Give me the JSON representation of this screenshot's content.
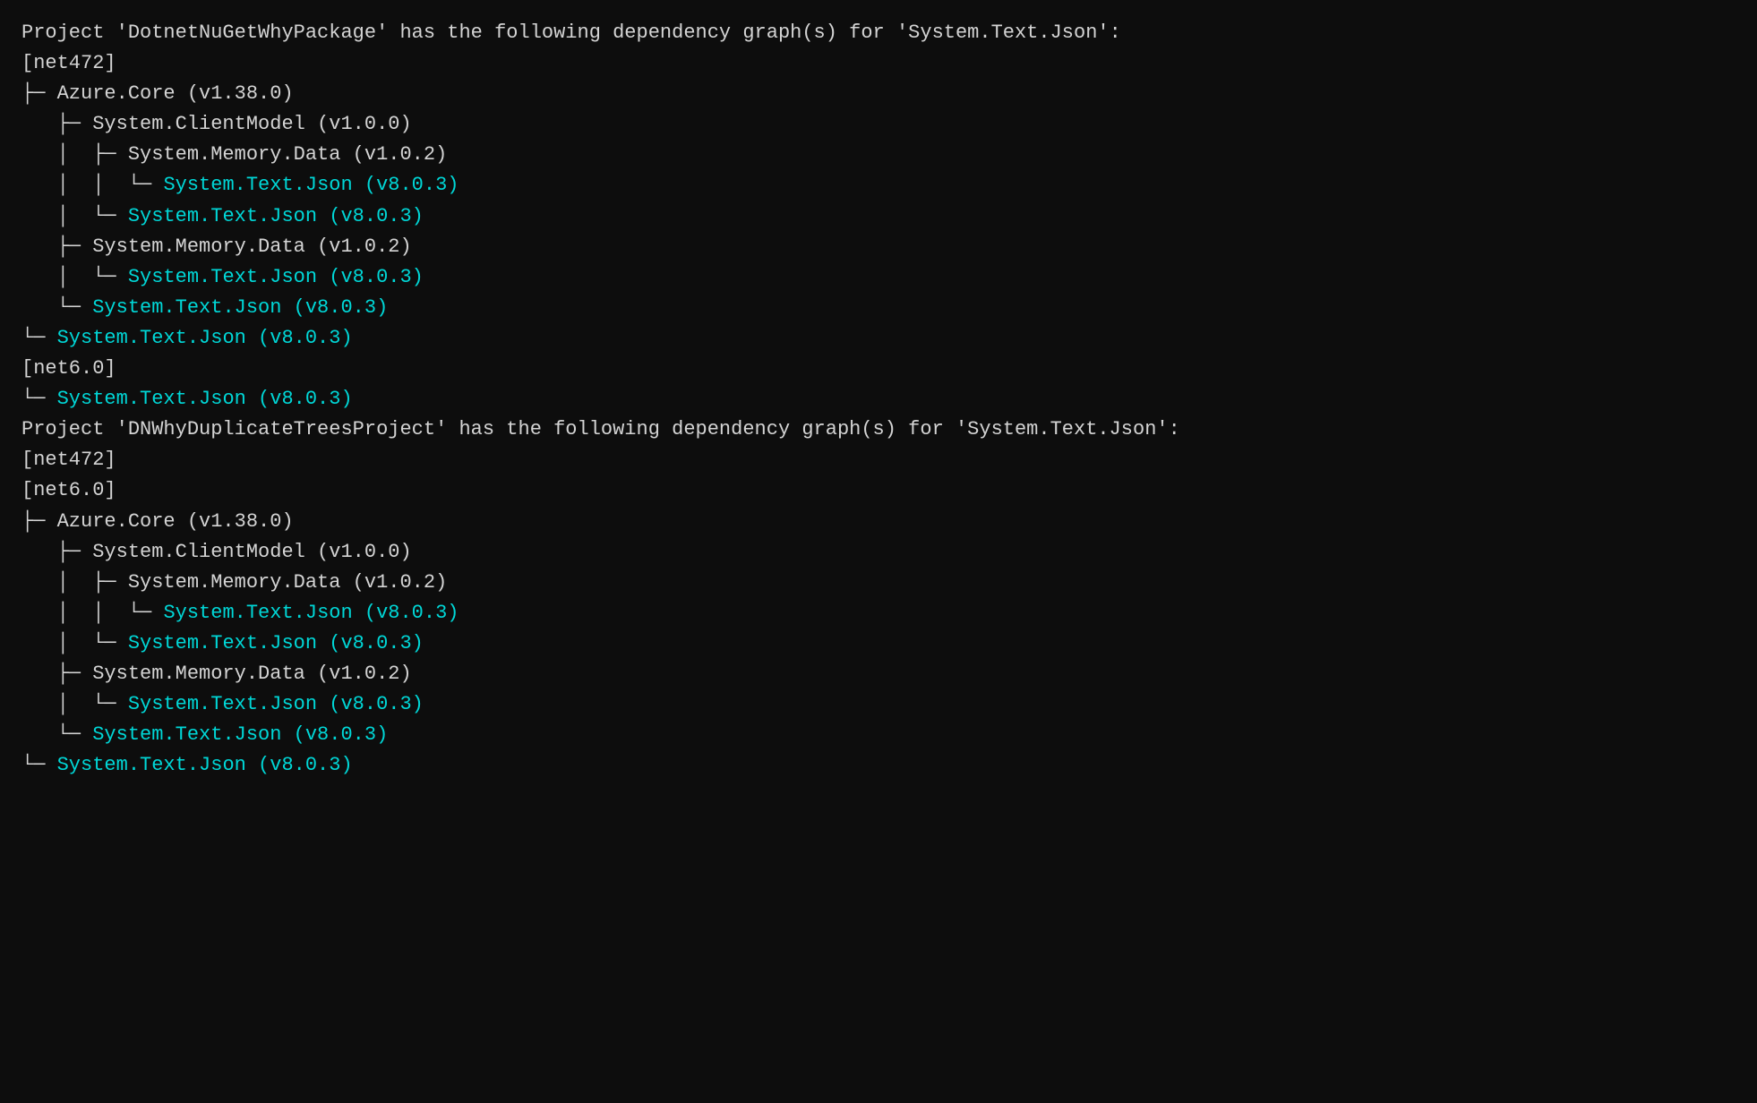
{
  "terminal": {
    "lines": [
      {
        "type": "white",
        "text": "Project 'DotnetNuGetWhyPackage' has the following dependency graph(s) for 'System.Text.Json':"
      },
      {
        "type": "white",
        "text": ""
      },
      {
        "type": "white",
        "text": "[net472]"
      },
      {
        "type": "white",
        "text": ""
      },
      {
        "type": "white",
        "text": "├─ Azure.Core (v1.38.0)"
      },
      {
        "type": "white",
        "text": "   ├─ System.ClientModel (v1.0.0)"
      },
      {
        "type": "white",
        "text": "   │  ├─ System.Memory.Data (v1.0.2)"
      },
      {
        "type": "mixed",
        "prefix": "   │  │  └─ ",
        "cyan": "System.Text.Json (v8.0.3)",
        "suffix": ""
      },
      {
        "type": "mixed",
        "prefix": "   │  └─ ",
        "cyan": "System.Text.Json (v8.0.3)",
        "suffix": ""
      },
      {
        "type": "white",
        "text": "   ├─ System.Memory.Data (v1.0.2)"
      },
      {
        "type": "mixed",
        "prefix": "   │  └─ ",
        "cyan": "System.Text.Json (v8.0.3)",
        "suffix": ""
      },
      {
        "type": "mixed",
        "prefix": "   └─ ",
        "cyan": "System.Text.Json (v8.0.3)",
        "suffix": ""
      },
      {
        "type": "mixed",
        "prefix": "└─ ",
        "cyan": "System.Text.Json (v8.0.3)",
        "suffix": ""
      },
      {
        "type": "white",
        "text": ""
      },
      {
        "type": "white",
        "text": "[net6.0]"
      },
      {
        "type": "white",
        "text": ""
      },
      {
        "type": "mixed",
        "prefix": "└─ ",
        "cyan": "System.Text.Json (v8.0.3)",
        "suffix": ""
      },
      {
        "type": "white",
        "text": ""
      },
      {
        "type": "white",
        "text": "Project 'DNWhyDuplicateTreesProject' has the following dependency graph(s) for 'System.Text.Json':"
      },
      {
        "type": "white",
        "text": ""
      },
      {
        "type": "white",
        "text": "[net472]"
      },
      {
        "type": "white",
        "text": "[net6.0]"
      },
      {
        "type": "white",
        "text": ""
      },
      {
        "type": "white",
        "text": "├─ Azure.Core (v1.38.0)"
      },
      {
        "type": "white",
        "text": "   ├─ System.ClientModel (v1.0.0)"
      },
      {
        "type": "white",
        "text": "   │  ├─ System.Memory.Data (v1.0.2)"
      },
      {
        "type": "mixed",
        "prefix": "   │  │  └─ ",
        "cyan": "System.Text.Json (v8.0.3)",
        "suffix": ""
      },
      {
        "type": "mixed",
        "prefix": "   │  └─ ",
        "cyan": "System.Text.Json (v8.0.3)",
        "suffix": ""
      },
      {
        "type": "white",
        "text": "   ├─ System.Memory.Data (v1.0.2)"
      },
      {
        "type": "mixed",
        "prefix": "   │  └─ ",
        "cyan": "System.Text.Json (v8.0.3)",
        "suffix": ""
      },
      {
        "type": "mixed",
        "prefix": "   └─ ",
        "cyan": "System.Text.Json (v8.0.3)",
        "suffix": ""
      },
      {
        "type": "mixed",
        "prefix": "└─ ",
        "cyan": "System.Text.Json (v8.0.3)",
        "suffix": ""
      }
    ]
  }
}
